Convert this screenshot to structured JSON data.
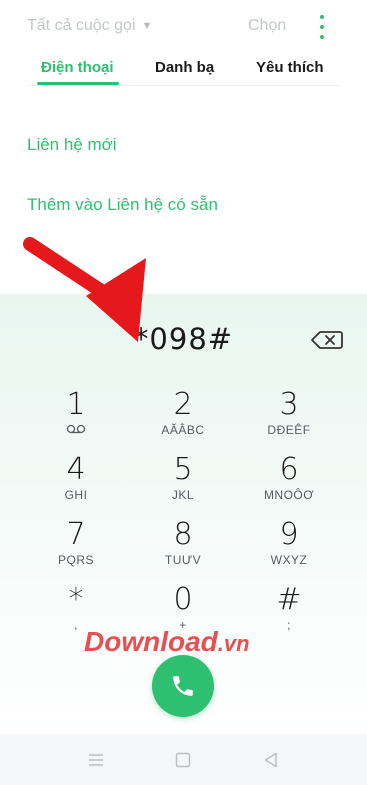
{
  "header": {
    "filter_label": "Tất cả cuộc gọi",
    "select_label": "Chọn"
  },
  "tabs": [
    {
      "label": "Điện thoại",
      "active": true
    },
    {
      "label": "Danh bạ",
      "active": false
    },
    {
      "label": "Yêu thích",
      "active": false
    }
  ],
  "actions": {
    "new_contact": "Liên hệ mới",
    "add_to_existing": "Thêm vào Liên hệ có sẵn"
  },
  "dialpad": {
    "entered_number": "*098#",
    "keys": [
      {
        "digit": "1",
        "sub": ""
      },
      {
        "digit": "2",
        "sub": "AĂÂBC"
      },
      {
        "digit": "3",
        "sub": "DĐEÊF"
      },
      {
        "digit": "4",
        "sub": "GHI"
      },
      {
        "digit": "5",
        "sub": "JKL"
      },
      {
        "digit": "6",
        "sub": "MNOÔƠ"
      },
      {
        "digit": "7",
        "sub": "PQRS"
      },
      {
        "digit": "8",
        "sub": "TUƯV"
      },
      {
        "digit": "9",
        "sub": "WXYZ"
      },
      {
        "digit": "*",
        "sub": ","
      },
      {
        "digit": "0",
        "sub": "+"
      },
      {
        "digit": "#",
        "sub": ";"
      }
    ]
  },
  "watermark": {
    "text": "Download",
    "suffix": ".vn"
  },
  "colors": {
    "accent": "#2fbf71",
    "annotation_arrow": "#e5191b",
    "watermark": "#e23a3a"
  },
  "icons": {
    "filter_caret": "caret-down-icon",
    "more": "more-vertical-icon",
    "backspace": "backspace-icon",
    "voicemail": "voicemail-icon",
    "call": "phone-icon",
    "nav_menu": "menu-icon",
    "nav_home": "home-square-icon",
    "nav_back": "back-triangle-icon"
  }
}
